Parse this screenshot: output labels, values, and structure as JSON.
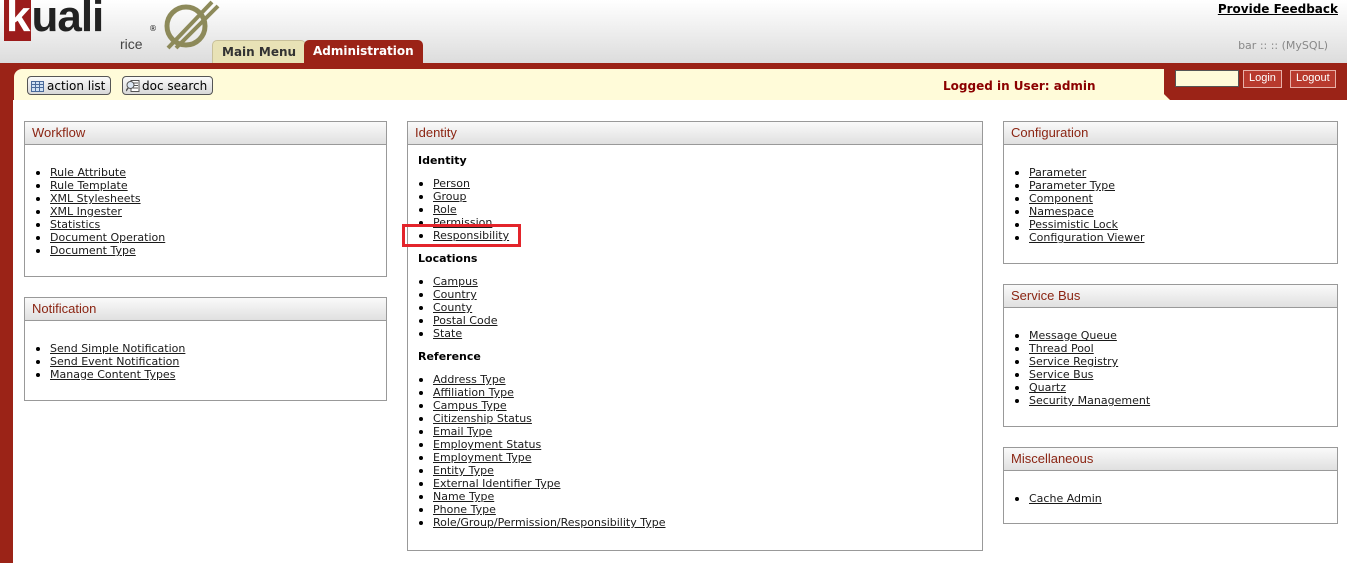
{
  "header": {
    "logo_text": "kuali",
    "logo_subtext": "rice",
    "logo_reg": "®",
    "tabs": [
      {
        "label": "Main Menu",
        "active": false
      },
      {
        "label": "Administration",
        "active": true
      }
    ],
    "feedback_link": "Provide Feedback",
    "db_info": "bar :: :: (MySQL)"
  },
  "toolbar": {
    "action_list_label": "action list",
    "doc_search_label": "doc search",
    "logged_in_text": "Logged in User: admin",
    "login_input_value": "",
    "login_label": "Login",
    "logout_label": "Logout"
  },
  "colors": {
    "brand_red": "#9b2317",
    "cream": "#fffbd9",
    "box_title": "#8b2513",
    "highlight": "#e3242b"
  },
  "sections": {
    "workflow": {
      "title": "Workflow",
      "items": [
        "Rule Attribute",
        "Rule Template",
        "XML Stylesheets",
        "XML Ingester",
        "Statistics",
        "Document Operation",
        "Document Type"
      ]
    },
    "notification": {
      "title": "Notification",
      "items": [
        "Send Simple Notification",
        "Send Event Notification",
        "Manage Content Types"
      ]
    },
    "identity": {
      "title": "Identity",
      "groups": [
        {
          "heading": "Identity",
          "items": [
            "Person",
            "Group",
            "Role",
            "Permission",
            "Responsibility"
          ]
        },
        {
          "heading": "Locations",
          "items": [
            "Campus",
            "Country",
            "County",
            "Postal Code",
            "State"
          ]
        },
        {
          "heading": "Reference",
          "items": [
            "Address Type",
            "Affiliation Type",
            "Campus Type",
            "Citizenship Status",
            "Email Type",
            "Employment Status",
            "Employment Type",
            "Entity Type",
            "External Identifier Type",
            "Name Type",
            "Phone Type",
            "Role/Group/Permission/Responsibility Type"
          ]
        }
      ]
    },
    "configuration": {
      "title": "Configuration",
      "items": [
        "Parameter",
        "Parameter Type",
        "Component",
        "Namespace",
        "Pessimistic Lock",
        "Configuration Viewer"
      ]
    },
    "servicebus": {
      "title": "Service Bus",
      "items": [
        "Message Queue",
        "Thread Pool",
        "Service Registry",
        "Service Bus",
        "Quartz",
        "Security Management"
      ]
    },
    "misc": {
      "title": "Miscellaneous",
      "items": [
        "Cache Admin"
      ]
    }
  },
  "highlighted_item": "Responsibility"
}
